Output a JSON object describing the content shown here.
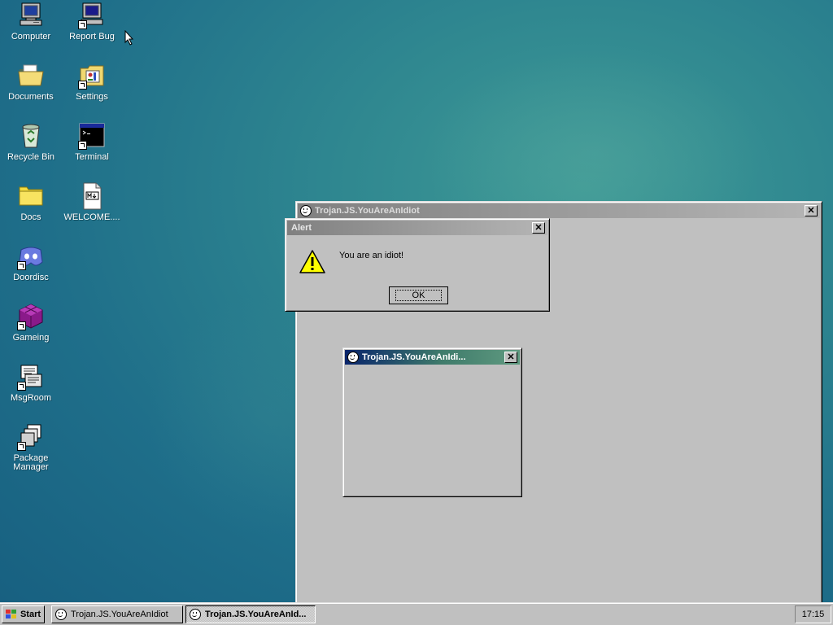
{
  "desktop_icons": [
    {
      "label": "Computer",
      "icon": "computer-icon"
    },
    {
      "label": "Report Bug",
      "icon": "report-bug-icon"
    },
    {
      "label": "Documents",
      "icon": "documents-folder-icon"
    },
    {
      "label": "Settings",
      "icon": "settings-icon"
    },
    {
      "label": "Recycle Bin",
      "icon": "recycle-bin-icon"
    },
    {
      "label": "Terminal",
      "icon": "terminal-icon"
    },
    {
      "label": "Docs",
      "icon": "docs-folder-icon"
    },
    {
      "label": "WELCOME....",
      "icon": "markdown-file-icon"
    },
    {
      "label": "Doordisc",
      "icon": "doordisc-icon"
    },
    {
      "label": "Gameing",
      "icon": "gameing-icon"
    },
    {
      "label": "MsgRoom",
      "icon": "msgroom-icon"
    },
    {
      "label": "Package Manager",
      "icon": "package-manager-icon"
    }
  ],
  "windows": {
    "main": {
      "title": "Trojan.JS.YouAreAnIdiot"
    },
    "small": {
      "title": "Trojan.JS.YouAreAnIdi..."
    },
    "alert": {
      "title": "Alert",
      "message": "You are an idiot!",
      "ok_label": "OK",
      "icon": "warning-icon"
    }
  },
  "close_glyph": "✕",
  "taskbar": {
    "start_label": "Start",
    "tasks": [
      {
        "label": "Trojan.JS.YouAreAnIdiot"
      },
      {
        "label": "Trojan.JS.YouAreAnId..."
      }
    ],
    "clock": "17:15"
  },
  "colors": {
    "active_title_start": "#08246b",
    "active_title_end": "#5f9a80",
    "inactive_title": "#808080",
    "face": "#c0c0c0"
  }
}
